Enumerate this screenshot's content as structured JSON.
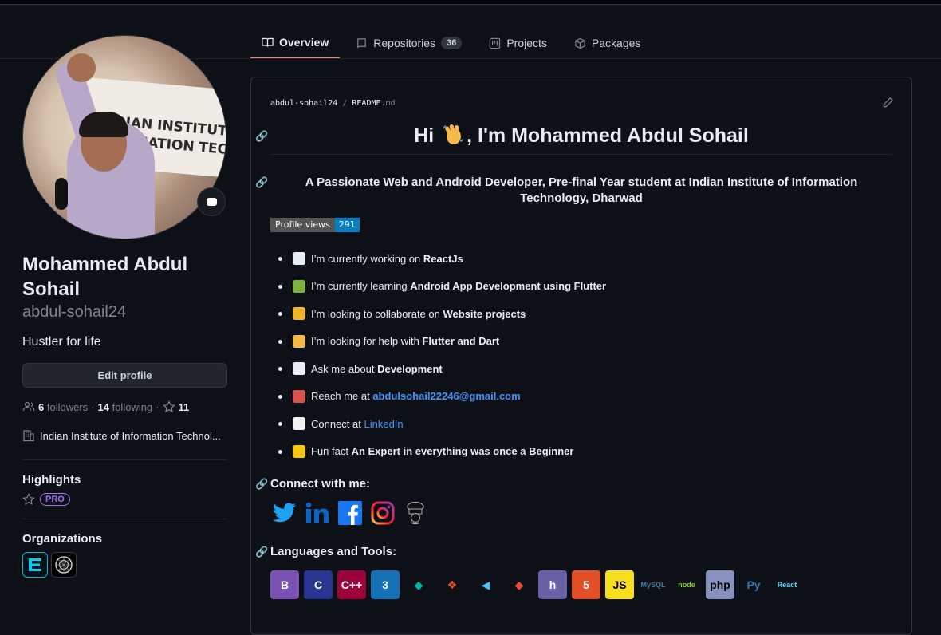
{
  "tabs": [
    {
      "label": "Overview",
      "active": true,
      "icon": "book-icon"
    },
    {
      "label": "Repositories",
      "count": "36",
      "icon": "repo-icon"
    },
    {
      "label": "Projects",
      "icon": "project-icon"
    },
    {
      "label": "Packages",
      "icon": "package-icon"
    }
  ],
  "profile": {
    "avatar_text1": "NDIAN INSTITUTE OF",
    "avatar_text2": "FORMATION TECHNC",
    "name": "Mohammed Abdul Sohail",
    "login": "abdul-sohail24",
    "bio": "Hustler for life",
    "edit_label": "Edit profile",
    "followers_count": "6",
    "followers_label": "followers",
    "following_count": "14",
    "following_label": "following",
    "stars_count": "11",
    "organization": "Indian Institute of Information Technol..."
  },
  "highlights": {
    "title": "Highlights",
    "badge": "PRO"
  },
  "organizations": {
    "title": "Organizations"
  },
  "readme": {
    "path_user": "abdul-sohail24",
    "path_sep": "/",
    "path_file": "README",
    "path_ext": ".md",
    "heading_pre": "Hi",
    "heading_post": ", I'm Mohammed Abdul Sohail",
    "subtitle": "A Passionate Web and Android Developer, Pre-final Year student at Indian Institute of Information Technology, Dharwad",
    "badge_label": "Profile views",
    "badge_value": "291",
    "facts": [
      {
        "pre": "I’m currently working on ",
        "bold": "ReactJs",
        "link": "",
        "emoji_color": "#e6edf3"
      },
      {
        "pre": "I’m currently learning ",
        "bold": "Android App Development using Flutter",
        "link": "",
        "emoji_color": "#7cb342"
      },
      {
        "pre": "I’m looking to collaborate on ",
        "bold": "Website projects",
        "link": "",
        "emoji_color": "#f0b429"
      },
      {
        "pre": "I’m looking for help with ",
        "bold": "Flutter and Dart",
        "link": "",
        "emoji_color": "#f5b94a"
      },
      {
        "pre": "Ask me about ",
        "bold": "Development",
        "link": "",
        "emoji_color": "#e6edf3"
      },
      {
        "pre": "Reach me at ",
        "bold": "",
        "link": "abdulsohail22246@gmail.com",
        "emoji_color": "#d9534f"
      },
      {
        "pre": "Connect at ",
        "bold": "",
        "link": "LinkedIn",
        "emoji_color": "#f2f2f2"
      },
      {
        "pre": "Fun fact ",
        "bold": "An Expert in everything was once a Beginner",
        "link": "",
        "emoji_color": "#f9c513"
      }
    ],
    "connect_title": "Connect with me:",
    "languages_title": "Languages and Tools:",
    "socials": [
      "twitter-icon",
      "linkedin-icon",
      "facebook-icon",
      "instagram-icon",
      "codechef-icon"
    ],
    "tools": [
      {
        "name": "bootstrap-icon",
        "text": "B",
        "bg": "#7952b3",
        "fg": "#ffffff"
      },
      {
        "name": "c-icon",
        "text": "C",
        "bg": "#283593",
        "fg": "#ffffff"
      },
      {
        "name": "cplusplus-icon",
        "text": "C++",
        "bg": "#9c033a",
        "fg": "#ffffff"
      },
      {
        "name": "css3-icon",
        "text": "3",
        "bg": "#1572b6",
        "fg": "#ffffff"
      },
      {
        "name": "dart-icon",
        "text": "◆",
        "bg": "#0d1117",
        "fg": "#00b4ab"
      },
      {
        "name": "figma-icon",
        "text": "❖",
        "bg": "#0d1117",
        "fg": "#f24e1e"
      },
      {
        "name": "flutter-icon",
        "text": "◀",
        "bg": "#0d1117",
        "fg": "#47c5fb"
      },
      {
        "name": "git-icon",
        "text": "◆",
        "bg": "#0d1117",
        "fg": "#e84d31"
      },
      {
        "name": "heroku-icon",
        "text": "h",
        "bg": "#6762a6",
        "fg": "#ffffff"
      },
      {
        "name": "html5-icon",
        "text": "5",
        "bg": "#e34f26",
        "fg": "#ffffff"
      },
      {
        "name": "javascript-icon",
        "text": "JS",
        "bg": "#f7df1e",
        "fg": "#000000"
      },
      {
        "name": "mysql-icon",
        "text": "MySQL",
        "bg": "#0d1117",
        "fg": "#4479a1"
      },
      {
        "name": "nodejs-icon",
        "text": "node",
        "bg": "#0d1117",
        "fg": "#83cd29"
      },
      {
        "name": "php-icon",
        "text": "php",
        "bg": "#8892bf",
        "fg": "#000000"
      },
      {
        "name": "python-icon",
        "text": "Py",
        "bg": "#0d1117",
        "fg": "#3776ab"
      },
      {
        "name": "react-icon",
        "text": "React",
        "bg": "#0d1117",
        "fg": "#61dafb"
      }
    ]
  },
  "colors": {
    "accent": "#f78166",
    "link": "#4493f8",
    "background": "#0d1117",
    "pro": "#a371f7"
  }
}
